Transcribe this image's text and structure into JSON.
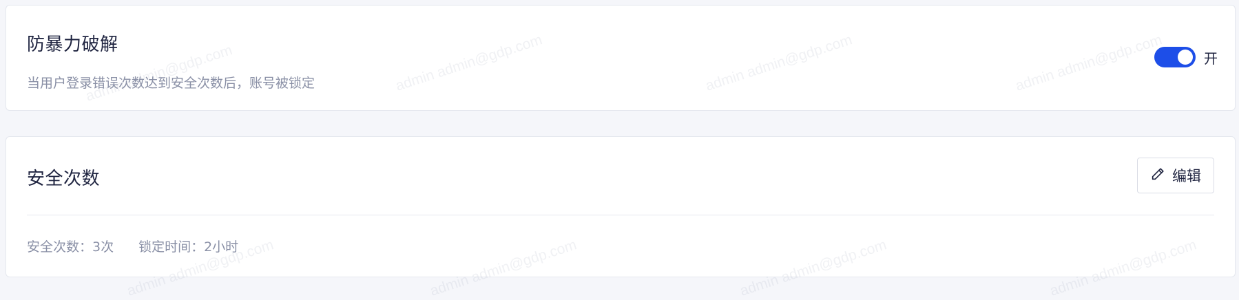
{
  "brute_force": {
    "title": "防暴力破解",
    "description": "当用户登录错误次数达到安全次数后，账号被锁定",
    "toggle_state": "开",
    "toggle_on": true
  },
  "security_count": {
    "title": "安全次数",
    "edit_label": "编辑",
    "attempts": "安全次数：3次",
    "lock_time": "锁定时间：2小时"
  },
  "watermark": {
    "text": "admin admin@gdp.com"
  },
  "colors": {
    "accent": "#1d4ee8",
    "background": "#f5f6fa",
    "text_primary": "#1f2440",
    "text_secondary": "#8a90a6"
  },
  "icons": {
    "edit": "pencil-icon"
  }
}
